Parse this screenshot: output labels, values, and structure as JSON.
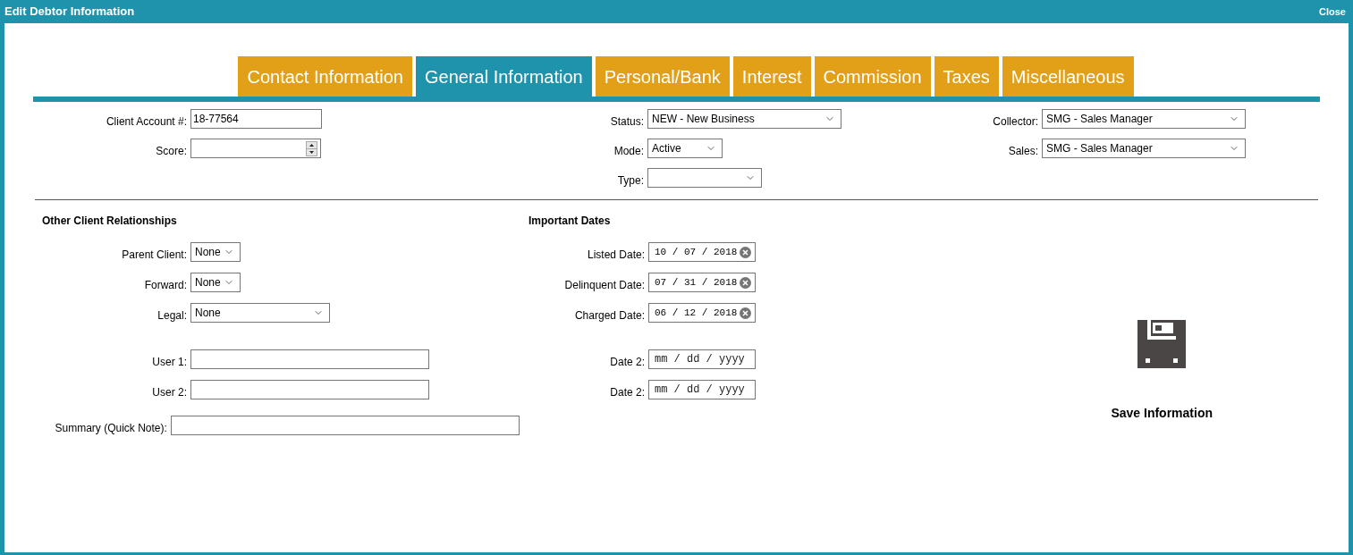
{
  "window": {
    "title": "Edit Debtor Information",
    "close": "Close"
  },
  "tabs": [
    {
      "label": "Contact Information",
      "selected": false
    },
    {
      "label": "General Information",
      "selected": true
    },
    {
      "label": "Personal/Bank",
      "selected": false
    },
    {
      "label": "Interest",
      "selected": false
    },
    {
      "label": "Commission",
      "selected": false
    },
    {
      "label": "Taxes",
      "selected": false
    },
    {
      "label": "Miscellaneous",
      "selected": false
    }
  ],
  "top_columns": [
    [
      {
        "label": "Client Account #:",
        "kind": "text",
        "value": "18-77564"
      },
      {
        "label": "Score:",
        "kind": "number"
      }
    ],
    [
      {
        "label": "Status:",
        "kind": "select",
        "value": "NEW - New Business"
      },
      {
        "label": "Mode:",
        "kind": "select",
        "value": "Active"
      },
      {
        "label": "Type:",
        "kind": "select"
      }
    ],
    [
      {
        "label": "Collector:",
        "kind": "select",
        "value": "SMG - Sales Manager"
      },
      {
        "label": "Sales:",
        "kind": "select",
        "value": "SMG - Sales Manager"
      }
    ]
  ],
  "sections": [
    {
      "heading": "Other Client Relationships",
      "fields": [
        {
          "label": "Parent Client:",
          "kind": "select",
          "value": "None"
        },
        {
          "label": "Forward:",
          "kind": "select",
          "value": "None"
        },
        {
          "label": "Legal:",
          "kind": "select",
          "value": "None"
        },
        {
          "label": "User 1:",
          "kind": "text"
        },
        {
          "label": "User 2:",
          "kind": "text"
        },
        {
          "label": "Summary (Quick Note):",
          "kind": "text"
        }
      ]
    },
    {
      "heading": "Important Dates",
      "fields": [
        {
          "label": "Listed Date:",
          "kind": "date",
          "value": "10 / 07 / 2018"
        },
        {
          "label": "Delinquent Date:",
          "kind": "date",
          "value": "07 / 31 / 2018"
        },
        {
          "label": "Charged Date:",
          "kind": "date",
          "value": "06 / 12 / 2018"
        },
        {
          "label": "Date 2:",
          "kind": "date",
          "placeholder": "mm / dd / yyyy"
        },
        {
          "label": "Date 2:",
          "kind": "date",
          "placeholder": "mm / dd / yyyy"
        }
      ]
    }
  ],
  "save_button": {
    "label": "Save Information"
  }
}
